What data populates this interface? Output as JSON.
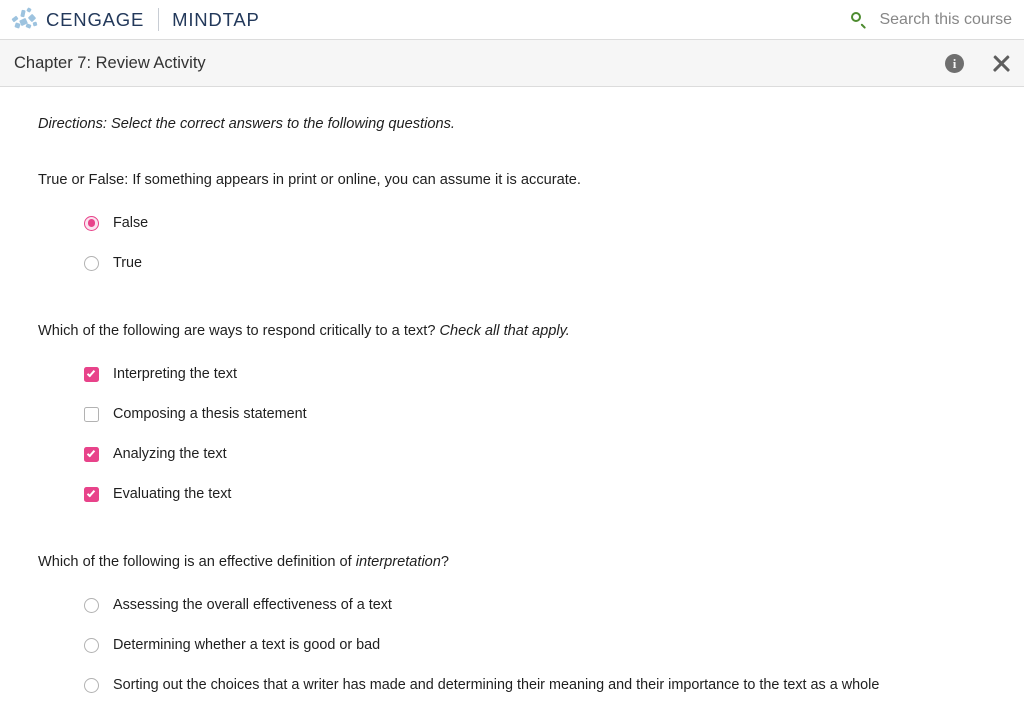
{
  "topbar": {
    "logo_icon": "cengage-dots-logo",
    "brand_primary": "CENGAGE",
    "brand_secondary": "MINDTAP",
    "search": {
      "icon": "search-icon",
      "placeholder": "Search this course"
    }
  },
  "activity_header": {
    "title": "Chapter 7: Review Activity",
    "info_icon": "info-icon",
    "info_glyph": "i",
    "close_icon": "close-icon"
  },
  "content": {
    "directions": "Directions: Select the correct answers to the following questions.",
    "questions": [
      {
        "text_before": "True or False: If something appears in print or online, you can assume it is accurate.",
        "text_italic": "",
        "text_after": "",
        "input_type": "radio",
        "options": [
          {
            "label": "False",
            "checked": true
          },
          {
            "label": "True",
            "checked": false
          }
        ]
      },
      {
        "text_before": "Which of the following are ways to respond critically to a text? ",
        "text_italic": "Check all that apply.",
        "text_after": "",
        "input_type": "checkbox",
        "options": [
          {
            "label": "Interpreting the text",
            "checked": true
          },
          {
            "label": "Composing a thesis statement",
            "checked": false
          },
          {
            "label": "Analyzing the text",
            "checked": true
          },
          {
            "label": "Evaluating the text",
            "checked": true
          }
        ]
      },
      {
        "text_before": "Which of the following is an effective definition of ",
        "text_italic": "interpretation",
        "text_after": "?",
        "input_type": "radio",
        "options": [
          {
            "label": "Assessing the overall effectiveness of a text",
            "checked": false
          },
          {
            "label": "Determining whether a text is good or bad",
            "checked": false
          },
          {
            "label": "Sorting out the choices that a writer has made and determining their meaning and their importance to the text as a whole",
            "checked": false
          }
        ]
      }
    ]
  },
  "colors": {
    "accent_pink": "#e8438a",
    "brand_navy": "#23395b",
    "search_green": "#4d8b2f",
    "header_bg": "#f6f6f6"
  }
}
